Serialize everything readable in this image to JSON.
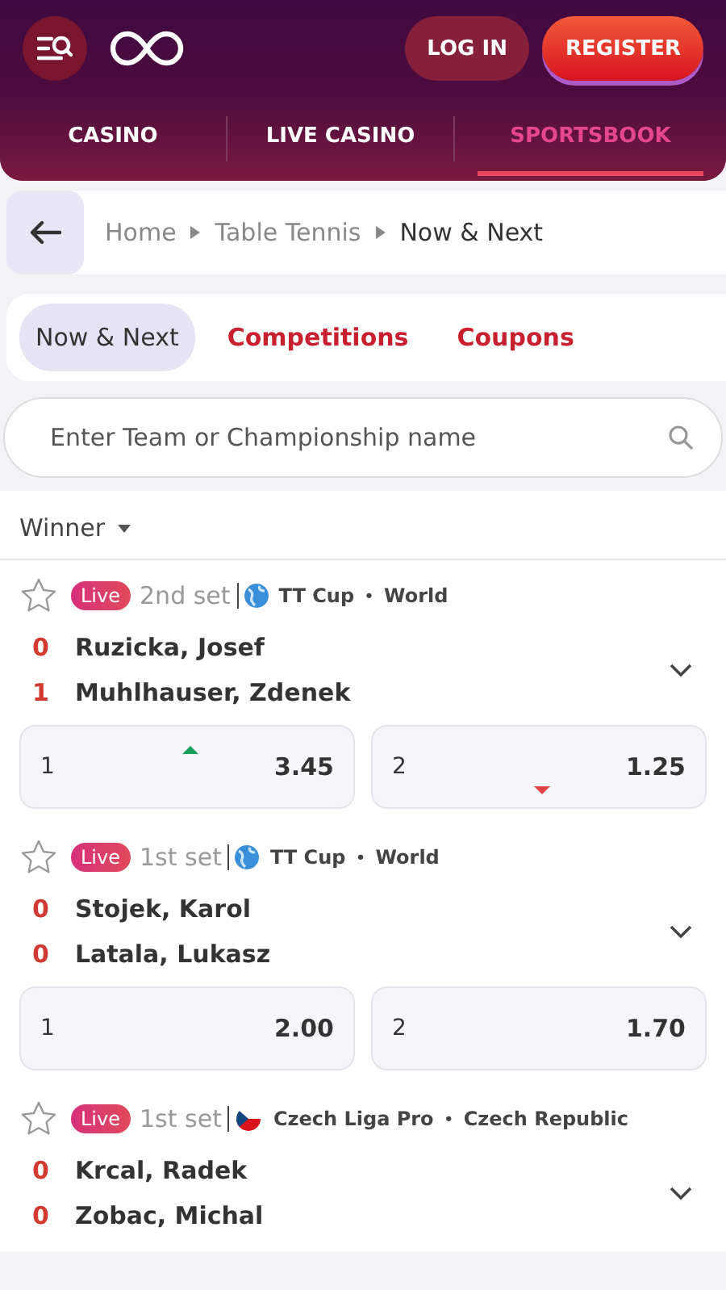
{
  "header": {
    "buttons": [
      {
        "label": "LOG IN",
        "kind": "login"
      },
      {
        "label": "REGISTER",
        "kind": "register"
      }
    ]
  },
  "nav": [
    {
      "label": "CASINO",
      "selected": false
    },
    {
      "label": "LIVE CASINO",
      "selected": false
    },
    {
      "label": "SPORTSBOOK",
      "selected": true
    }
  ],
  "breadcrumb": [
    {
      "label": "Home",
      "current": false
    },
    {
      "label": "Table Tennis",
      "current": false
    },
    {
      "label": "Now & Next",
      "current": true
    }
  ],
  "tabs": [
    {
      "label": "Now & Next",
      "selected": true
    },
    {
      "label": "Competitions",
      "selected": false
    },
    {
      "label": "Coupons",
      "selected": false
    }
  ],
  "search": {
    "placeholder": "Enter Team or Championship name"
  },
  "market": "Winner",
  "matches": [
    {
      "favorite": false,
      "live": "Live",
      "period": "2nd set",
      "flag": {
        "kind": "globe"
      },
      "competition": "TT Cup",
      "separator": "•",
      "region": "World",
      "players": [
        {
          "score": "0",
          "name": "Ruzicka, Josef"
        },
        {
          "score": "1",
          "name": "Muhlhauser, Zdenek"
        }
      ],
      "odds": [
        {
          "label": "1",
          "price": "3.45",
          "rising": true,
          "falling": false
        },
        {
          "label": "2",
          "price": "1.25",
          "rising": false,
          "falling": true
        }
      ]
    },
    {
      "favorite": false,
      "live": "Live",
      "period": "1st set",
      "flag": {
        "kind": "globe"
      },
      "competition": "TT Cup",
      "separator": "•",
      "region": "World",
      "players": [
        {
          "score": "0",
          "name": "Stojek, Karol"
        },
        {
          "score": "0",
          "name": "Latala, Lukasz"
        }
      ],
      "odds": [
        {
          "label": "1",
          "price": "2.00",
          "rising": false,
          "falling": false
        },
        {
          "label": "2",
          "price": "1.70",
          "rising": false,
          "falling": false
        }
      ]
    },
    {
      "favorite": false,
      "live": "Live",
      "period": "1st set",
      "flag": {
        "kind": "czech"
      },
      "competition": "Czech Liga Pro",
      "separator": "•",
      "region": "Czech Republic",
      "players": [
        {
          "score": "0",
          "name": "Krcal, Radek"
        },
        {
          "score": "0",
          "name": "Zobac, Michal"
        }
      ]
    }
  ]
}
